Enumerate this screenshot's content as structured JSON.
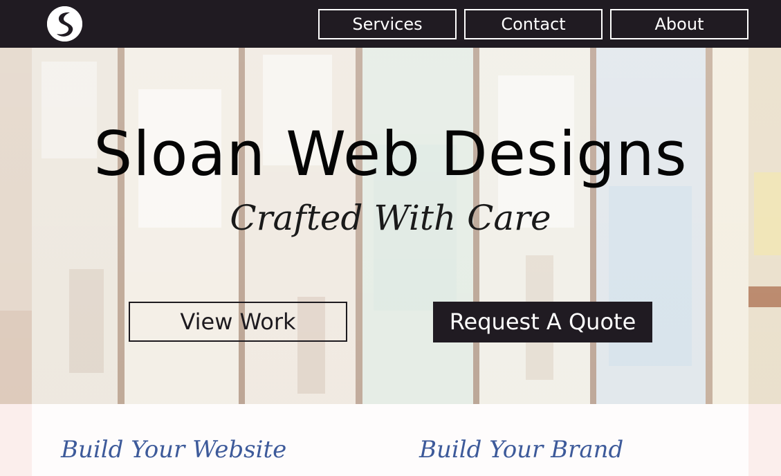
{
  "colors": {
    "nav_background": "#201b22",
    "nav_text": "#ffffff",
    "hero_text": "#050505",
    "quote_button_background": "#201b22",
    "section_heading": "#3d5a9a",
    "panel_background": "#fefcfc"
  },
  "header": {
    "logo_icon": "s-logo-icon",
    "nav": {
      "services_label": "Services",
      "contact_label": "Contact",
      "about_label": "About"
    }
  },
  "hero": {
    "background": "painted-wood-planks-image",
    "title": "Sloan Web Designs",
    "subtitle": "Crafted With Care",
    "view_work_label": "View Work",
    "request_quote_label": "Request A Quote"
  },
  "sections": {
    "website_heading": "Build Your Website",
    "brand_heading": "Build Your Brand"
  }
}
